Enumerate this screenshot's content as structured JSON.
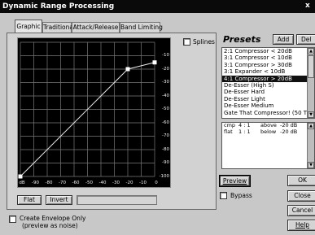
{
  "window": {
    "title": "Dynamic Range Processing",
    "close_glyph": "x"
  },
  "tabs": [
    {
      "label": "Graphic",
      "active": true
    },
    {
      "label": "Traditional",
      "active": false
    },
    {
      "label": "Attack/Release",
      "active": false
    },
    {
      "label": "Band Limiting",
      "active": false
    }
  ],
  "graph": {
    "y_ticks": [
      "-10",
      "-20",
      "-30",
      "-40",
      "-50",
      "-60",
      "-70",
      "-80",
      "-90",
      "-100"
    ],
    "x_ticks": [
      "dB",
      "-90",
      "-80",
      "-70",
      "-60",
      "-50",
      "-40",
      "-30",
      "-20",
      "-10",
      "0"
    ],
    "axis_unit": "dB",
    "colors": {
      "background": "#000000",
      "grid": "#7a7a7a",
      "curve": "#e8e8e8",
      "point": "#ffffff"
    },
    "curve_points_db": [
      {
        "input": -100,
        "output": -100
      },
      {
        "input": -20,
        "output": -20
      },
      {
        "input": 0,
        "output": -15
      }
    ]
  },
  "splines": {
    "label": "Splines",
    "checked": false
  },
  "graph_buttons": {
    "flat": "Flat",
    "invert": "Invert"
  },
  "envelope": {
    "line1": "Create Envelope Only",
    "line2": "(preview as noise)",
    "checked": false
  },
  "presets": {
    "title": "Presets",
    "add": "Add",
    "del": "Del",
    "items": [
      "2:1 Compressor < 20dB",
      "3:1 Compressor < 10dB",
      "3:1 Compressor > 30dB",
      "3:1 Expander < 10dB",
      "4:1 Compressor > 20dB",
      "De-Esser (High S)",
      "De-Esser Hard",
      "De-Esser Light",
      "De-Esser Medium",
      "Gate That Compressor! (50 Thr"
    ],
    "selected_index": 4
  },
  "info": {
    "rows": [
      {
        "type": "cmp",
        "ratio": "4 : 1",
        "dir": "above",
        "level": "-20 dB"
      },
      {
        "type": "flat",
        "ratio": "1 : 1",
        "dir": "below",
        "level": "-20 dB"
      }
    ]
  },
  "buttons": {
    "preview": "Preview",
    "ok": "OK",
    "close": "Close",
    "cancel": "Cancel",
    "help": "Help"
  },
  "bypass": {
    "label": "Bypass",
    "checked": false
  }
}
